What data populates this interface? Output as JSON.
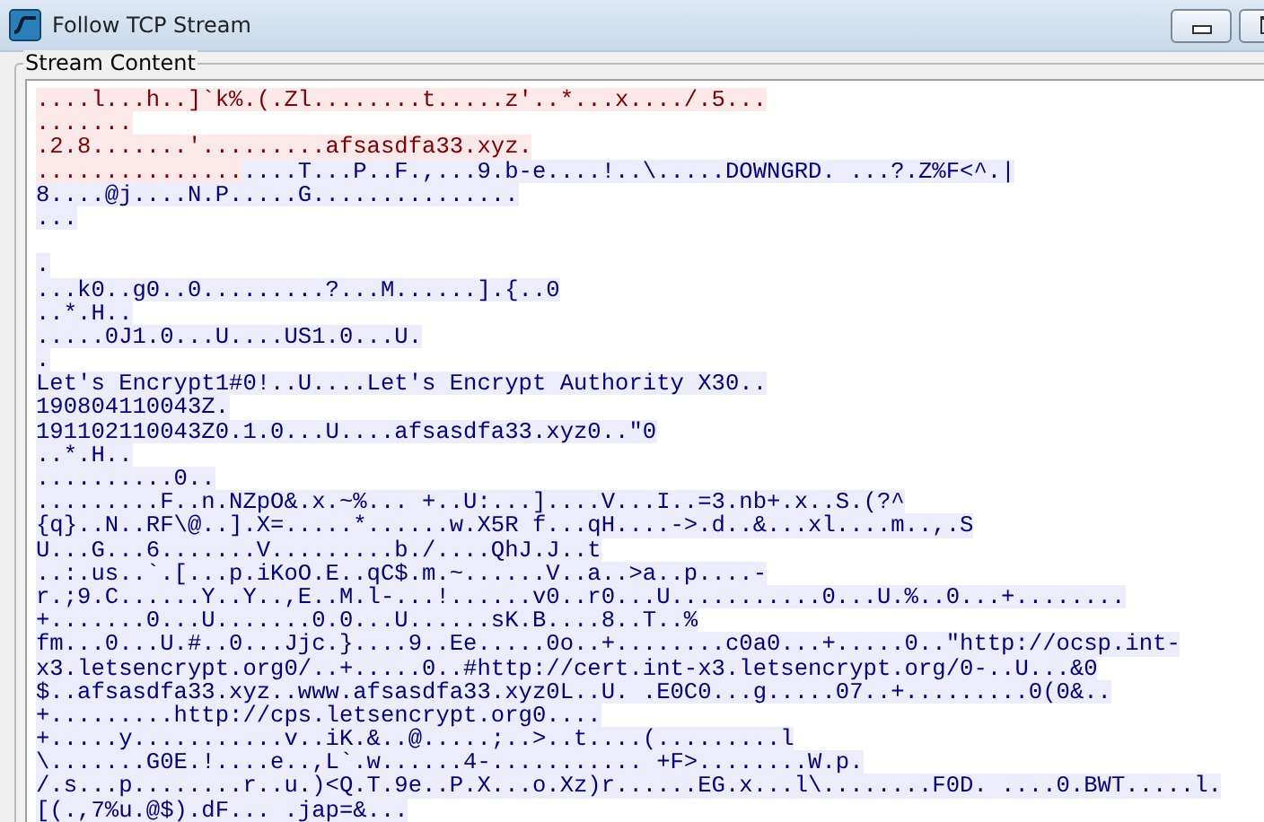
{
  "window": {
    "title": "Follow TCP Stream"
  },
  "group": {
    "title": "Stream Content"
  },
  "lines": [
    {
      "kind": "text",
      "segments": [
        {
          "kind": "client",
          "text": "....l...h..]`k%.(.Zl........t.....z'..*...x..../.5..."
        }
      ]
    },
    {
      "kind": "text",
      "segments": [
        {
          "kind": "client",
          "text": "......."
        }
      ]
    },
    {
      "kind": "text",
      "segments": [
        {
          "kind": "client",
          "text": ".2.8.......'.........afsasdfa33.xyz."
        }
      ]
    },
    {
      "kind": "text",
      "segments": [
        {
          "kind": "client",
          "text": "..............."
        },
        {
          "kind": "server",
          "text": "....T...P..F.,...9.b-e....!..\\.....DOWNGRD. ...?.Z%F<^.|"
        }
      ]
    },
    {
      "kind": "text",
      "segments": [
        {
          "kind": "server",
          "text": "8....@j....N.P.....G..............."
        }
      ]
    },
    {
      "kind": "text",
      "segments": [
        {
          "kind": "server",
          "text": "..."
        }
      ]
    },
    {
      "kind": "blank"
    },
    {
      "kind": "text",
      "segments": [
        {
          "kind": "server",
          "text": "."
        }
      ]
    },
    {
      "kind": "text",
      "segments": [
        {
          "kind": "server",
          "text": "...k0..g0..0.........?...M......].{..0"
        }
      ]
    },
    {
      "kind": "text",
      "segments": [
        {
          "kind": "server",
          "text": "..*.H.."
        }
      ]
    },
    {
      "kind": "text",
      "segments": [
        {
          "kind": "server",
          "text": ".....0J1.0...U....US1.0...U."
        }
      ]
    },
    {
      "kind": "text",
      "segments": [
        {
          "kind": "server",
          "text": "."
        }
      ]
    },
    {
      "kind": "text",
      "segments": [
        {
          "kind": "server",
          "text": "Let's Encrypt1#0!..U....Let's Encrypt Authority X30.."
        }
      ]
    },
    {
      "kind": "text",
      "segments": [
        {
          "kind": "server",
          "text": "190804110043Z."
        }
      ]
    },
    {
      "kind": "text",
      "segments": [
        {
          "kind": "server",
          "text": "191102110043Z0.1.0...U....afsasdfa33.xyz0..\"0"
        }
      ]
    },
    {
      "kind": "text",
      "segments": [
        {
          "kind": "server",
          "text": "..*.H.."
        }
      ]
    },
    {
      "kind": "text",
      "segments": [
        {
          "kind": "server",
          "text": "..........0.."
        }
      ]
    },
    {
      "kind": "text",
      "segments": [
        {
          "kind": "server",
          "text": ".........F..n.NZpO&.x.~%... +..U:...]....V...I..=3.nb+.x..S.(?^"
        }
      ]
    },
    {
      "kind": "text",
      "segments": [
        {
          "kind": "server",
          "text": "{q}..N..RF\\@..].X=.....*......w.X5R f...qH....->.d..&...xl....m..,.S"
        }
      ]
    },
    {
      "kind": "text",
      "segments": [
        {
          "kind": "server",
          "text": "U...G...6.......V.........b./....QhJ.J..t"
        }
      ]
    },
    {
      "kind": "text",
      "segments": [
        {
          "kind": "server",
          "text": "..:.us..`.[...p.iKoO.E..qC$.m.~......V..a..>a..p....-"
        }
      ]
    },
    {
      "kind": "text",
      "segments": [
        {
          "kind": "server",
          "text": "r.;9.C......Y..Y..,E..M.l-...!......v0..r0...U...........0...U.%..0...+........"
        }
      ]
    },
    {
      "kind": "text",
      "segments": [
        {
          "kind": "server",
          "text": "+.......0...U.......0.0...U......sK.B....8..T..%"
        }
      ]
    },
    {
      "kind": "text",
      "segments": [
        {
          "kind": "server",
          "text": "fm...0...U.#..0...Jjc.}....9..Ee.....0o..+........c0a0...+.....0..\"http://ocsp.int-"
        }
      ]
    },
    {
      "kind": "text",
      "segments": [
        {
          "kind": "server",
          "text": "x3.letsencrypt.org0/..+.....0..#http://cert.int-x3.letsencrypt.org/0-..U...&0"
        }
      ]
    },
    {
      "kind": "text",
      "segments": [
        {
          "kind": "server",
          "text": "$..afsasdfa33.xyz..www.afsasdfa33.xyz0L..U. .E0C0...g.....07..+.........0(0&.."
        }
      ]
    },
    {
      "kind": "text",
      "segments": [
        {
          "kind": "server",
          "text": "+.........http://cps.letsencrypt.org0...."
        }
      ]
    },
    {
      "kind": "text",
      "segments": [
        {
          "kind": "server",
          "text": "+.....y...........v..iK.&..@.....;..>..t....(.........l"
        }
      ]
    },
    {
      "kind": "text",
      "segments": [
        {
          "kind": "server",
          "text": "\\.......G0E.!....e..,L`.w......4-........... +F>........W.p."
        }
      ]
    },
    {
      "kind": "text",
      "segments": [
        {
          "kind": "server",
          "text": "/.s...p........r..u.)<Q.T.9e..P.X...o.Xz)r......EG.x...l\\........F0D. ....0.BWT.....l."
        }
      ]
    },
    {
      "kind": "text",
      "segments": [
        {
          "kind": "server",
          "text": "[(.,7%u.@$).dF... .jap=&..."
        }
      ]
    }
  ]
}
